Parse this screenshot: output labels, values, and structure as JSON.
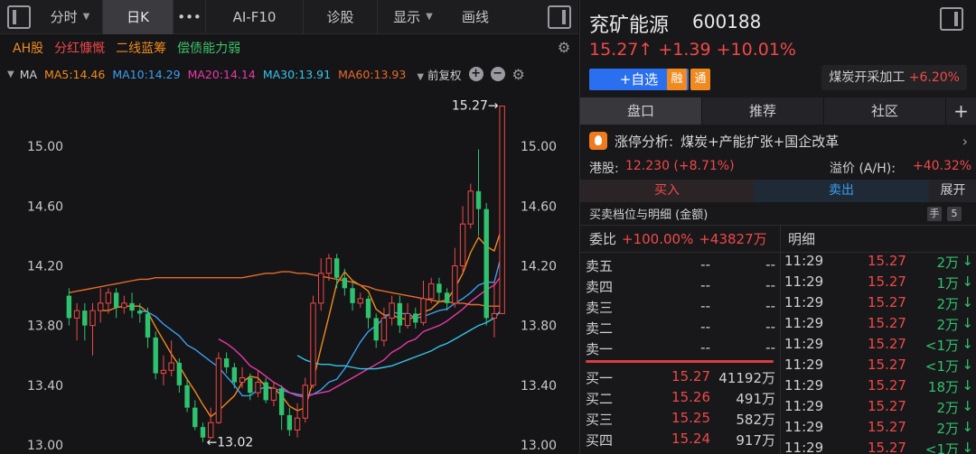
{
  "toolbar": {
    "items": [
      {
        "label": "分时",
        "arrow": "▼"
      },
      {
        "label": "日K",
        "arrow": ""
      },
      {
        "label": "•••",
        "arrow": ""
      },
      {
        "label": "AI-F10",
        "arrow": ""
      },
      {
        "label": "诊股",
        "arrow": ""
      },
      {
        "label": "显示",
        "arrow": "▼"
      },
      {
        "label": "画线",
        "arrow": ""
      }
    ]
  },
  "tags": [
    {
      "label": "AH股",
      "color": "#f08a1e"
    },
    {
      "label": "分红慷慨",
      "color": "#f04848"
    },
    {
      "label": "二线蓝筹",
      "color": "#f08a1e"
    },
    {
      "label": "偿债能力弱",
      "color": "#3cc46a"
    }
  ],
  "ma_bar": {
    "label": "MA",
    "items": [
      {
        "label": "MA5:14.46",
        "color": "#f08a1e"
      },
      {
        "label": "MA10:14.29",
        "color": "#3a9ef0"
      },
      {
        "label": "MA20:14.14",
        "color": "#e83aa8"
      },
      {
        "label": "MA30:13.91",
        "color": "#33c4e8"
      },
      {
        "label": "MA60:13.93",
        "color": "#e86a2a"
      }
    ],
    "adjust": "前复权"
  },
  "chart_data": {
    "type": "candlestick",
    "ylim": [
      13.0,
      15.4
    ],
    "yticks": [
      "15.00",
      "14.60",
      "14.20",
      "13.80",
      "13.40",
      "13.00"
    ],
    "ytick_values": [
      15.0,
      14.6,
      14.2,
      13.8,
      13.4,
      13.0
    ],
    "max_label": "15.27→",
    "min_label": "←13.02",
    "up_color": "#f04848",
    "down_color": "#2fc26e",
    "candles": [
      [
        14.0,
        13.85,
        14.05,
        13.8
      ],
      [
        13.85,
        13.9,
        13.95,
        13.7
      ],
      [
        13.9,
        13.8,
        13.95,
        13.7
      ],
      [
        13.8,
        13.9,
        13.95,
        13.6
      ],
      [
        13.9,
        13.95,
        14.05,
        13.82
      ],
      [
        13.95,
        14.02,
        14.05,
        13.88
      ],
      [
        14.02,
        13.92,
        14.05,
        13.85
      ],
      [
        13.92,
        13.95,
        14.0,
        13.88
      ],
      [
        13.95,
        13.9,
        14.02,
        13.85
      ],
      [
        13.9,
        13.88,
        13.95,
        13.82
      ],
      [
        13.88,
        13.72,
        13.92,
        13.65
      ],
      [
        13.72,
        13.48,
        13.76,
        13.44
      ],
      [
        13.48,
        13.5,
        13.6,
        13.4
      ],
      [
        13.5,
        13.55,
        13.7,
        13.46
      ],
      [
        13.55,
        13.4,
        13.58,
        13.35
      ],
      [
        13.4,
        13.25,
        13.45,
        13.22
      ],
      [
        13.25,
        13.12,
        13.3,
        13.1
      ],
      [
        13.12,
        13.05,
        13.15,
        13.02
      ],
      [
        13.05,
        13.15,
        13.25,
        13.04
      ],
      [
        13.15,
        13.58,
        13.62,
        13.14
      ],
      [
        13.58,
        13.52,
        13.62,
        13.48
      ],
      [
        13.52,
        13.42,
        13.55,
        13.38
      ],
      [
        13.42,
        13.45,
        13.52,
        13.38
      ],
      [
        13.45,
        13.35,
        13.48,
        13.3
      ],
      [
        13.35,
        13.42,
        13.5,
        13.32
      ],
      [
        13.42,
        13.3,
        13.45,
        13.28
      ],
      [
        13.3,
        13.38,
        13.42,
        13.26
      ],
      [
        13.38,
        13.2,
        13.4,
        13.1
      ],
      [
        13.2,
        13.1,
        13.25,
        13.06
      ],
      [
        13.1,
        13.18,
        13.28,
        13.05
      ],
      [
        13.18,
        13.4,
        13.45,
        13.15
      ],
      [
        13.4,
        13.95,
        14.0,
        13.38
      ],
      [
        13.95,
        14.15,
        14.25,
        13.9
      ],
      [
        14.15,
        14.25,
        14.28,
        14.1
      ],
      [
        14.25,
        14.12,
        14.28,
        14.05
      ],
      [
        14.12,
        14.05,
        14.18,
        14.0
      ],
      [
        14.05,
        13.95,
        14.1,
        13.9
      ],
      [
        13.95,
        13.98,
        14.02,
        13.92
      ],
      [
        13.98,
        13.85,
        14.0,
        13.78
      ],
      [
        13.85,
        13.7,
        13.88,
        13.65
      ],
      [
        13.7,
        13.85,
        13.92,
        13.66
      ],
      [
        13.85,
        13.95,
        14.0,
        13.8
      ],
      [
        13.95,
        13.8,
        14.0,
        13.75
      ],
      [
        13.8,
        13.88,
        13.95,
        13.78
      ],
      [
        13.88,
        13.82,
        13.92,
        13.78
      ],
      [
        13.82,
        13.98,
        14.1,
        13.8
      ],
      [
        13.98,
        14.08,
        14.12,
        13.95
      ],
      [
        14.08,
        14.02,
        14.12,
        13.96
      ],
      [
        14.02,
        13.95,
        14.05,
        13.9
      ],
      [
        13.95,
        14.2,
        14.32,
        13.92
      ],
      [
        14.2,
        14.48,
        14.6,
        14.15
      ],
      [
        14.48,
        14.7,
        14.75,
        14.45
      ],
      [
        14.7,
        14.58,
        14.98,
        14.4
      ],
      [
        14.58,
        13.85,
        14.62,
        13.8
      ],
      [
        13.85,
        13.88,
        14.1,
        13.72
      ],
      [
        13.88,
        15.27,
        15.27,
        13.88
      ]
    ],
    "ma": [
      {
        "name": "MA5",
        "color": "#f08a1e",
        "values": [
          null,
          null,
          null,
          null,
          13.9,
          13.9,
          13.92,
          13.93,
          13.93,
          13.93,
          13.89,
          13.79,
          13.7,
          13.61,
          13.53,
          13.44,
          13.36,
          13.27,
          13.19,
          13.23,
          13.28,
          13.33,
          13.42,
          13.46,
          13.45,
          13.39,
          13.38,
          13.33,
          13.26,
          13.23,
          13.25,
          13.43,
          13.65,
          13.86,
          14.08,
          14.16,
          14.1,
          14.07,
          14.03,
          13.91,
          13.87,
          13.87,
          13.85,
          13.84,
          13.86,
          13.89,
          13.91,
          13.96,
          13.97,
          14.05,
          14.15,
          14.29,
          14.39,
          14.33,
          14.3,
          14.46
        ]
      },
      {
        "name": "MA10",
        "color": "#3a9ef0",
        "values": [
          null,
          null,
          null,
          null,
          null,
          null,
          null,
          null,
          null,
          13.9,
          13.89,
          13.86,
          13.81,
          13.77,
          13.73,
          13.67,
          13.64,
          13.6,
          13.56,
          13.52,
          13.46,
          13.4,
          13.33,
          13.33,
          13.37,
          13.39,
          13.37,
          13.37,
          13.35,
          13.34,
          13.33,
          13.34,
          13.37,
          13.42,
          13.44,
          13.51,
          13.6,
          13.69,
          13.76,
          13.8,
          13.85,
          13.89,
          13.88,
          13.88,
          13.85,
          13.86,
          13.88,
          13.9,
          13.91,
          13.95,
          13.98,
          14.02,
          14.07,
          14.09,
          14.09,
          14.29
        ]
      },
      {
        "name": "MA20",
        "color": "#e83aa8",
        "values": [
          null,
          null,
          null,
          null,
          null,
          null,
          null,
          null,
          null,
          null,
          null,
          null,
          null,
          null,
          null,
          null,
          null,
          null,
          null,
          13.71,
          13.68,
          13.64,
          13.59,
          13.53,
          13.5,
          13.46,
          13.42,
          13.39,
          13.35,
          13.33,
          13.32,
          13.34,
          13.35,
          13.36,
          13.39,
          13.42,
          13.45,
          13.48,
          13.51,
          13.54,
          13.57,
          13.62,
          13.65,
          13.69,
          13.71,
          13.76,
          13.78,
          13.8,
          13.83,
          13.87,
          13.91,
          13.96,
          14.0,
          14.04,
          14.07,
          14.14
        ]
      },
      {
        "name": "MA30",
        "color": "#33c4e8",
        "values": [
          null,
          null,
          null,
          null,
          null,
          null,
          null,
          null,
          null,
          null,
          null,
          null,
          null,
          null,
          null,
          null,
          null,
          null,
          null,
          null,
          null,
          null,
          null,
          null,
          null,
          null,
          null,
          null,
          null,
          13.6,
          13.57,
          13.55,
          13.54,
          13.54,
          13.53,
          13.53,
          13.52,
          13.51,
          13.51,
          13.51,
          13.52,
          13.53,
          13.55,
          13.57,
          13.59,
          13.61,
          13.63,
          13.66,
          13.68,
          13.71,
          13.74,
          13.77,
          13.8,
          13.82,
          13.85,
          13.91
        ]
      },
      {
        "name": "MA60",
        "color": "#e86a2a",
        "values": [
          14.02,
          14.03,
          14.04,
          14.05,
          14.06,
          14.07,
          14.08,
          14.09,
          14.1,
          14.11,
          14.11,
          14.12,
          14.12,
          14.12,
          14.12,
          14.12,
          14.12,
          14.12,
          14.12,
          14.12,
          14.12,
          14.12,
          14.12,
          14.13,
          14.14,
          14.15,
          14.15,
          14.16,
          14.16,
          14.15,
          14.15,
          14.14,
          14.13,
          14.12,
          14.11,
          14.1,
          14.09,
          14.07,
          14.06,
          14.04,
          14.03,
          14.02,
          14.01,
          14.0,
          13.99,
          13.98,
          13.97,
          13.96,
          13.96,
          13.95,
          13.95,
          13.94,
          13.94,
          13.93,
          13.93,
          13.93
        ]
      }
    ]
  },
  "stock": {
    "name": "兖矿能源",
    "code": "600188",
    "price_line": "15.27↑ +1.39 +10.01%",
    "add_label": "+自选",
    "rong": "融",
    "tong": "通",
    "sector_name": "煤炭开采加工",
    "sector_change": "+6.20%"
  },
  "tabs": [
    {
      "label": "盘口"
    },
    {
      "label": "推荐"
    },
    {
      "label": "社区"
    },
    {
      "label": "+"
    }
  ],
  "reason": {
    "label": "涨停分析:",
    "text": "煤炭+产能扩张+国企改革"
  },
  "hk": {
    "label": "港股:",
    "value": "12.230 (+8.71%)",
    "premium_label": "溢价 (A/H):",
    "premium_value": "+40.32%"
  },
  "trade": {
    "buy": "买入",
    "sell": "卖出",
    "expand": "展开"
  },
  "detail_head": {
    "label": "买卖档位与明细 (金额)",
    "badge_hand": "手",
    "badge_num": "5"
  },
  "book": {
    "ratio_label": "委比",
    "ratio_value": "+100.00%",
    "ratio_amount": "+43827万",
    "asks": [
      {
        "label": "卖五",
        "price": "--",
        "amount": "--"
      },
      {
        "label": "卖四",
        "price": "--",
        "amount": "--"
      },
      {
        "label": "卖三",
        "price": "--",
        "amount": "--"
      },
      {
        "label": "卖二",
        "price": "--",
        "amount": "--"
      },
      {
        "label": "卖一",
        "price": "--",
        "amount": "--"
      }
    ],
    "bids": [
      {
        "label": "买一",
        "price": "15.27",
        "amount": "41192万"
      },
      {
        "label": "买二",
        "price": "15.26",
        "amount": "491万"
      },
      {
        "label": "买三",
        "price": "15.25",
        "amount": "582万"
      },
      {
        "label": "买四",
        "price": "15.24",
        "amount": "917万"
      }
    ]
  },
  "ticks": {
    "header": "明细",
    "rows": [
      {
        "time": "11:29",
        "price": "15.27",
        "amount": "2万",
        "arrow": "↓"
      },
      {
        "time": "11:29",
        "price": "15.27",
        "amount": "1万",
        "arrow": "↓"
      },
      {
        "time": "11:29",
        "price": "15.27",
        "amount": "2万",
        "arrow": "↓"
      },
      {
        "time": "11:29",
        "price": "15.27",
        "amount": "2万",
        "arrow": "↓"
      },
      {
        "time": "11:29",
        "price": "15.27",
        "amount": "<1万",
        "arrow": "↓"
      },
      {
        "time": "11:29",
        "price": "15.27",
        "amount": "<1万",
        "arrow": "↓"
      },
      {
        "time": "11:29",
        "price": "15.27",
        "amount": "18万",
        "arrow": "↓"
      },
      {
        "time": "11:29",
        "price": "15.27",
        "amount": "2万",
        "arrow": "↓"
      },
      {
        "time": "11:29",
        "price": "15.27",
        "amount": "2万",
        "arrow": "↓"
      },
      {
        "time": "11:29",
        "price": "15.27",
        "amount": "<1万",
        "arrow": "↓"
      }
    ]
  },
  "colors": {
    "up": "#f04848",
    "down": "#2fc26e",
    "accent": "#2a6ff0",
    "orange": "#f08a1e"
  }
}
